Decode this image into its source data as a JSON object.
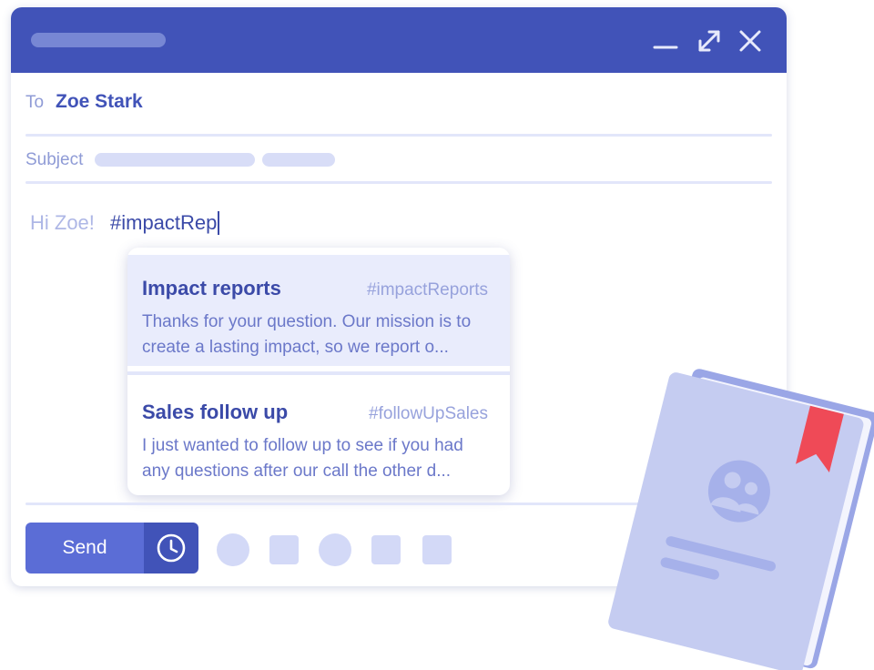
{
  "compose": {
    "to_label": "To",
    "to_value": "Zoe Stark",
    "subject_label": "Subject",
    "body": {
      "greeting": "Hi Zoe!",
      "typed": "#impactRep"
    }
  },
  "suggestions": [
    {
      "title": "Impact reports",
      "tag": "#impactReports",
      "line1": "Thanks for your question. Our mission is to",
      "line2": "create a lasting impact, so we report o..."
    },
    {
      "title": "Sales follow up",
      "tag": "#followUpSales",
      "line1": "I just wanted to follow up to see if you had",
      "line2": "any questions after our call the other d..."
    }
  ],
  "toolbar": {
    "send_label": "Send",
    "schedule_icon": "clock-icon"
  },
  "window_controls": {
    "icons": [
      "minimize-icon",
      "expand-icon",
      "close-icon"
    ]
  },
  "colors": {
    "accent": "#4153b8",
    "send": "#5b6dd6",
    "bookmark": "#ef4a57",
    "book": "#c5ccf1"
  }
}
